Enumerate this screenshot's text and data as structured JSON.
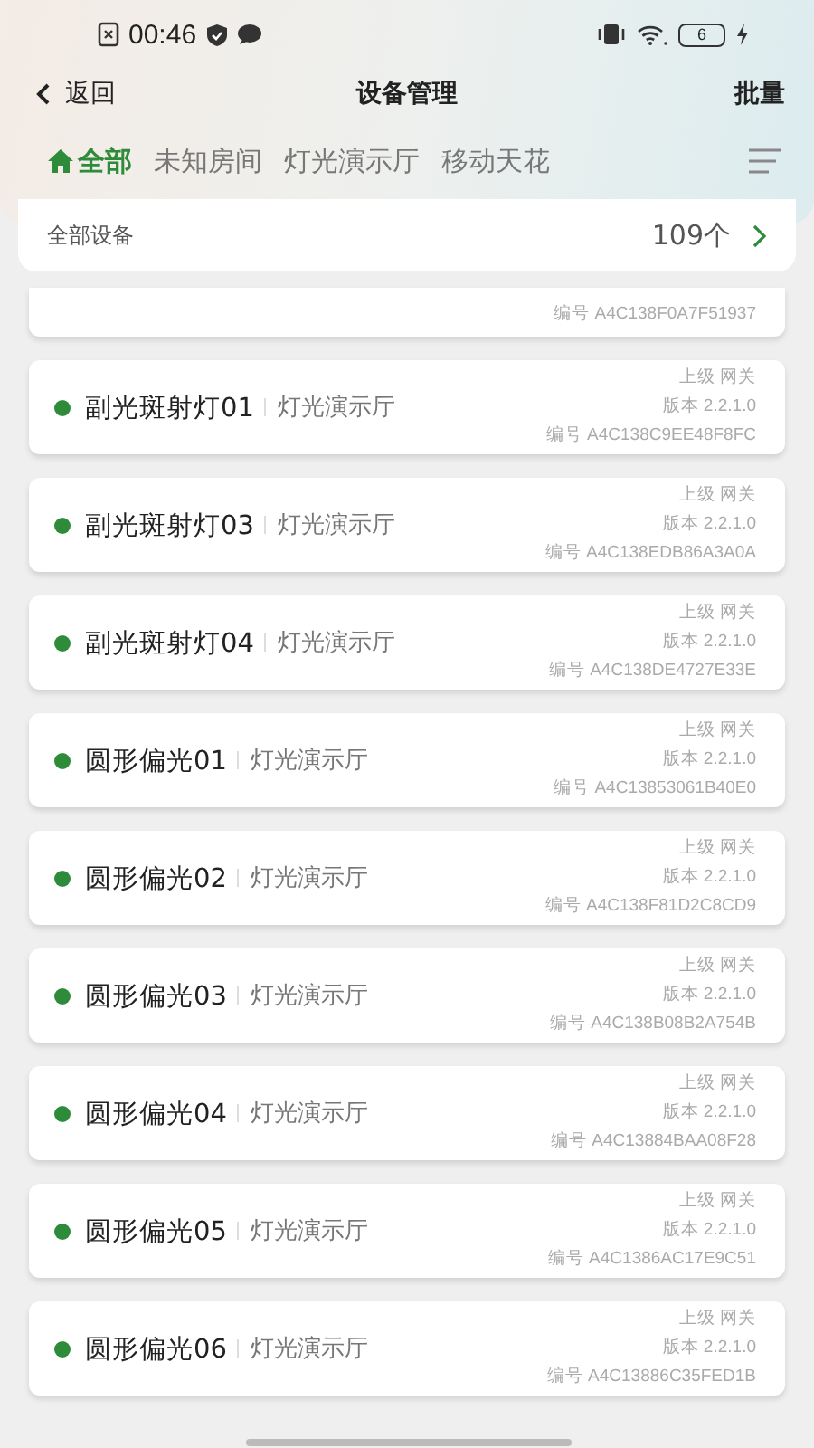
{
  "status_bar": {
    "time": "00:46",
    "battery": "6"
  },
  "nav": {
    "back": "返回",
    "title": "设备管理",
    "action": "批量"
  },
  "tabs": [
    {
      "label": "全部",
      "selected": true,
      "kind": "home"
    },
    {
      "label": "未知房间",
      "selected": false,
      "kind": "room"
    },
    {
      "label": "灯光演示厅",
      "selected": false,
      "kind": "room"
    },
    {
      "label": "移动天花",
      "selected": false,
      "kind": "room"
    }
  ],
  "summary": {
    "label": "全部设备",
    "count": "109个"
  },
  "devices": [
    {
      "kind": "partial",
      "serial": "编号 A4C138F0A7F51937"
    },
    {
      "kind": "full",
      "name": "副光斑射灯01",
      "room": "灯光演示厅",
      "parent": "上级 网关",
      "version": "版本 2.2.1.0",
      "serial": "编号 A4C138C9EE48F8FC",
      "color": "#2e8b3a"
    },
    {
      "kind": "full",
      "name": "副光斑射灯03",
      "room": "灯光演示厅",
      "parent": "上级 网关",
      "version": "版本 2.2.1.0",
      "serial": "编号 A4C138EDB86A3A0A",
      "color": "#2e8b3a"
    },
    {
      "kind": "full",
      "name": "副光斑射灯04",
      "room": "灯光演示厅",
      "parent": "上级 网关",
      "version": "版本 2.2.1.0",
      "serial": "编号 A4C138DE4727E33E",
      "color": "#2e8b3a"
    },
    {
      "kind": "full",
      "name": "圆形偏光01",
      "room": "灯光演示厅",
      "parent": "上级 网关",
      "version": "版本 2.2.1.0",
      "serial": "编号 A4C13853061B40E0",
      "color": "#2e8b3a"
    },
    {
      "kind": "full",
      "name": "圆形偏光02",
      "room": "灯光演示厅",
      "parent": "上级 网关",
      "version": "版本 2.2.1.0",
      "serial": "编号 A4C138F81D2C8CD9",
      "color": "#2e8b3a"
    },
    {
      "kind": "full",
      "name": "圆形偏光03",
      "room": "灯光演示厅",
      "parent": "上级 网关",
      "version": "版本 2.2.1.0",
      "serial": "编号 A4C138B08B2A754B",
      "color": "#2e8b3a"
    },
    {
      "kind": "full",
      "name": "圆形偏光04",
      "room": "灯光演示厅",
      "parent": "上级 网关",
      "version": "版本 2.2.1.0",
      "serial": "编号 A4C13884BAA08F28",
      "color": "#2e8b3a"
    },
    {
      "kind": "full",
      "name": "圆形偏光05",
      "room": "灯光演示厅",
      "parent": "上级 网关",
      "version": "版本 2.2.1.0",
      "serial": "编号 A4C1386AC17E9C51",
      "color": "#2e8b3a"
    },
    {
      "kind": "full",
      "name": "圆形偏光06",
      "room": "灯光演示厅",
      "parent": "上级 网关",
      "version": "版本 2.2.1.0",
      "serial": "编号 A4C13886C35FED1B",
      "color": "#2e8b3a"
    }
  ]
}
